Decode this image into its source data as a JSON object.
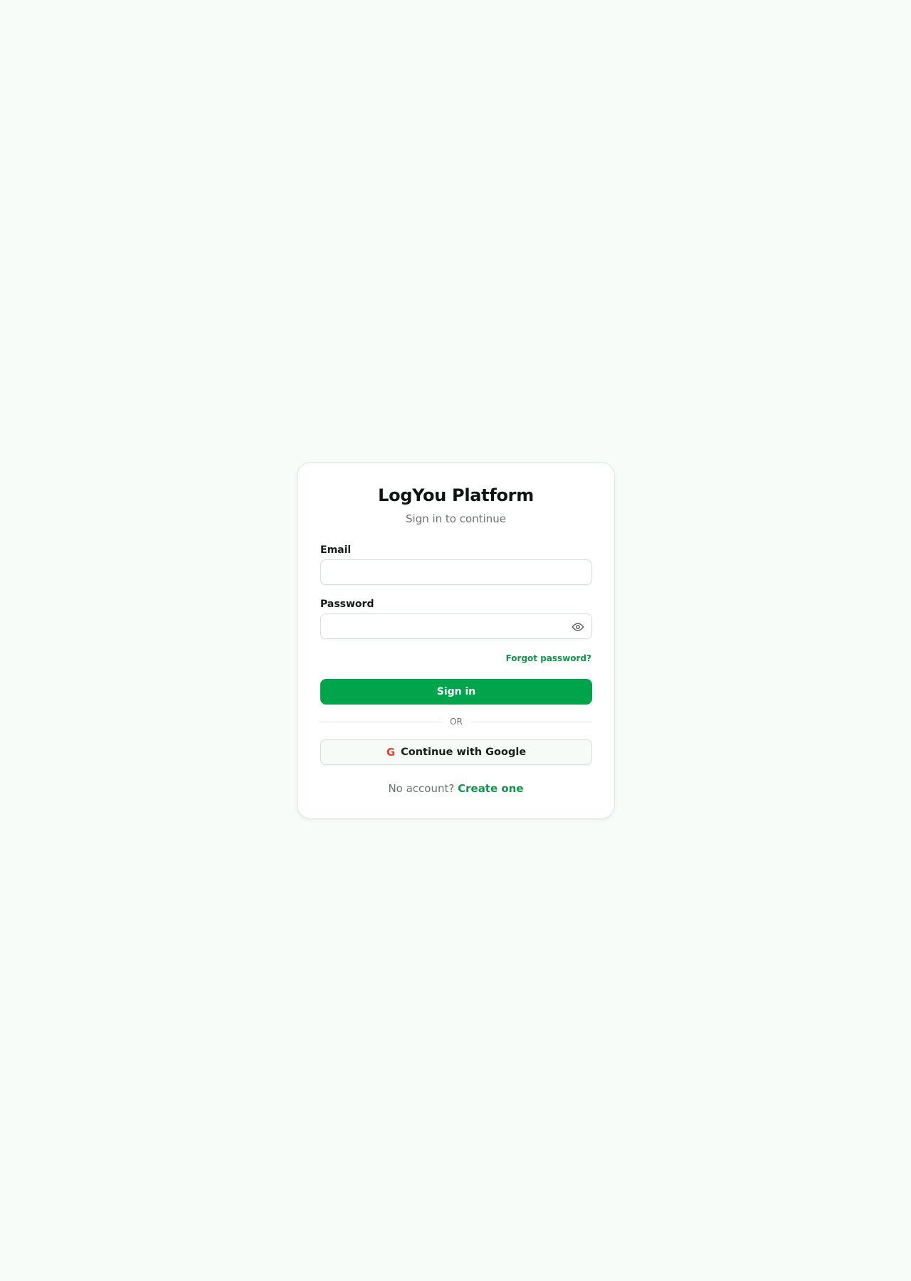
{
  "login": {
    "title": "LogYou Platform",
    "subtitle": "Sign in to continue",
    "email_label": "Email",
    "email_value": "",
    "password_label": "Password",
    "password_value": "",
    "forgot_label": "Forgot password?",
    "signin_label": "Sign in",
    "divider_text": "OR",
    "google_label": "Continue with Google",
    "no_account_text": "No account?",
    "create_label": "Create one"
  },
  "icons": {
    "password_toggle": "eye-icon",
    "google": "google-icon"
  },
  "colors": {
    "background": "#f7fcf8",
    "accent": "#00a54b",
    "link": "#12924a",
    "google_red": "#e0442e"
  }
}
